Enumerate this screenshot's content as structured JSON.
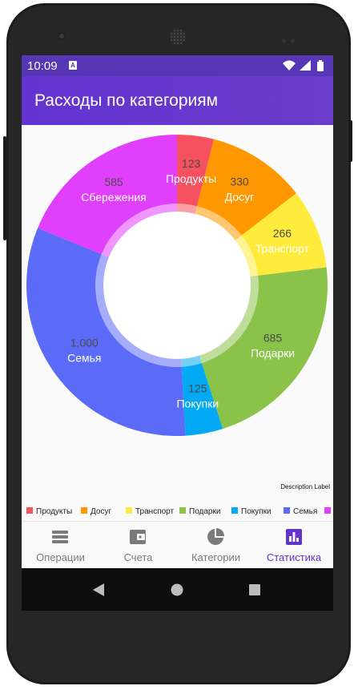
{
  "status_bar": {
    "time": "10:09",
    "notification_badge": "A"
  },
  "app_bar": {
    "title": "Расходы по категориям"
  },
  "chart_data": {
    "type": "pie",
    "style": "donut",
    "categories": [
      "Продукты",
      "Досуг",
      "Транспорт",
      "Подарки",
      "Покупки",
      "Семья",
      "Сбережения"
    ],
    "values": [
      123,
      330,
      266,
      685,
      125,
      1000,
      585
    ],
    "value_labels": [
      "123",
      "330",
      "266",
      "685",
      "125",
      "1,000",
      "585"
    ],
    "colors": [
      "#f5515f",
      "#ff9800",
      "#ffeb3b",
      "#8bc34a",
      "#03a9f4",
      "#5c6bf7",
      "#e040fb"
    ],
    "description_label": "Description Label",
    "legend_position": "bottom"
  },
  "legend_items": [
    {
      "label": "Продукты",
      "color": "#f5515f"
    },
    {
      "label": "Досуг",
      "color": "#ff9800"
    },
    {
      "label": "Транспорт",
      "color": "#ffeb3b"
    },
    {
      "label": "Подарки",
      "color": "#8bc34a"
    },
    {
      "label": "Покупки",
      "color": "#03a9f4"
    },
    {
      "label": "Семья",
      "color": "#5c6bf7"
    },
    {
      "label": "",
      "color": "#e040fb"
    }
  ],
  "bottom_nav": {
    "items": [
      {
        "label": "Операции",
        "icon": "list-icon",
        "active": false
      },
      {
        "label": "Счета",
        "icon": "wallet-icon",
        "active": false
      },
      {
        "label": "Категории",
        "icon": "pie-chart-icon",
        "active": false
      },
      {
        "label": "Статистика",
        "icon": "bar-chart-icon",
        "active": true
      }
    ]
  },
  "colors": {
    "primary": "#6333d1",
    "status_bar": "#5636b4",
    "inactive": "#7a7a7a"
  }
}
